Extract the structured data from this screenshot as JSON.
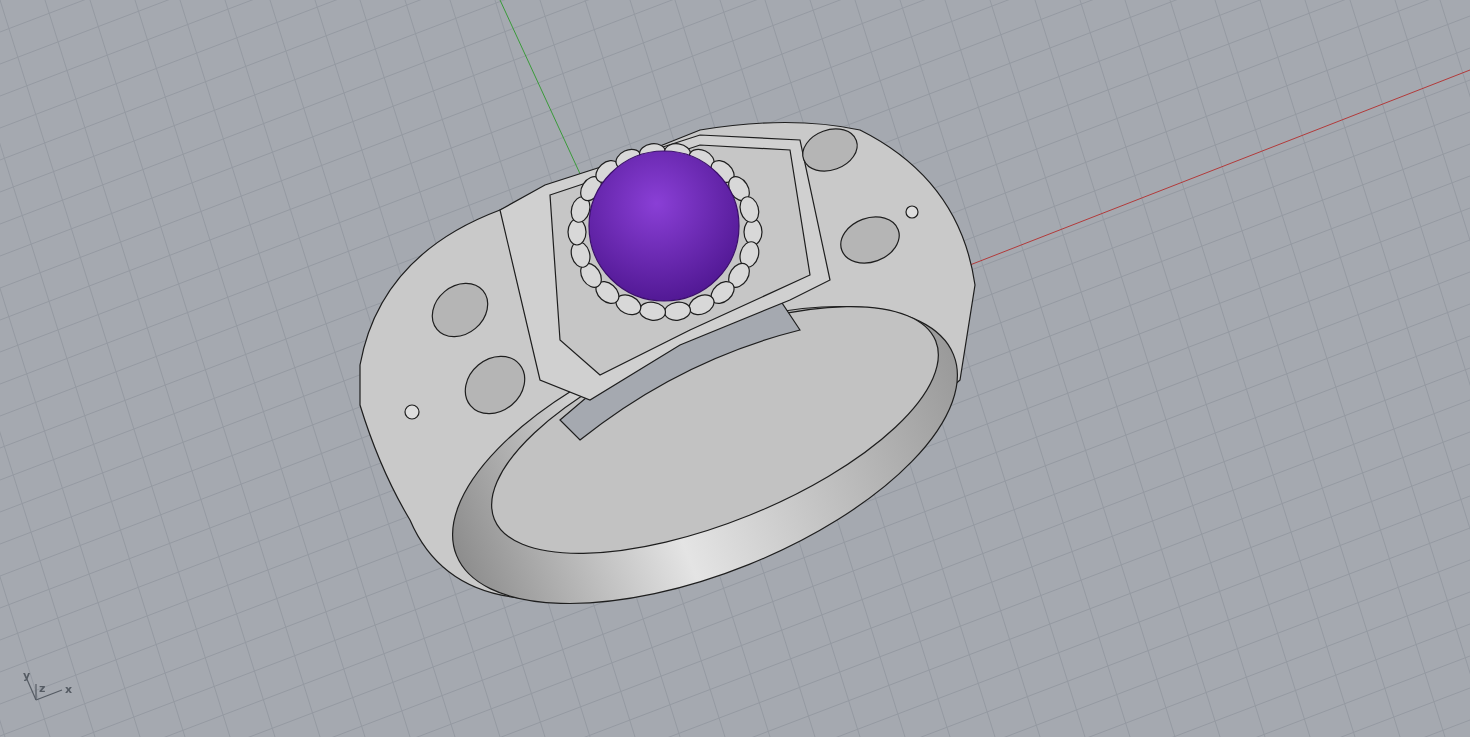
{
  "viewport": {
    "axis_gizmo": {
      "labels": [
        "y",
        "z",
        "x"
      ]
    }
  }
}
